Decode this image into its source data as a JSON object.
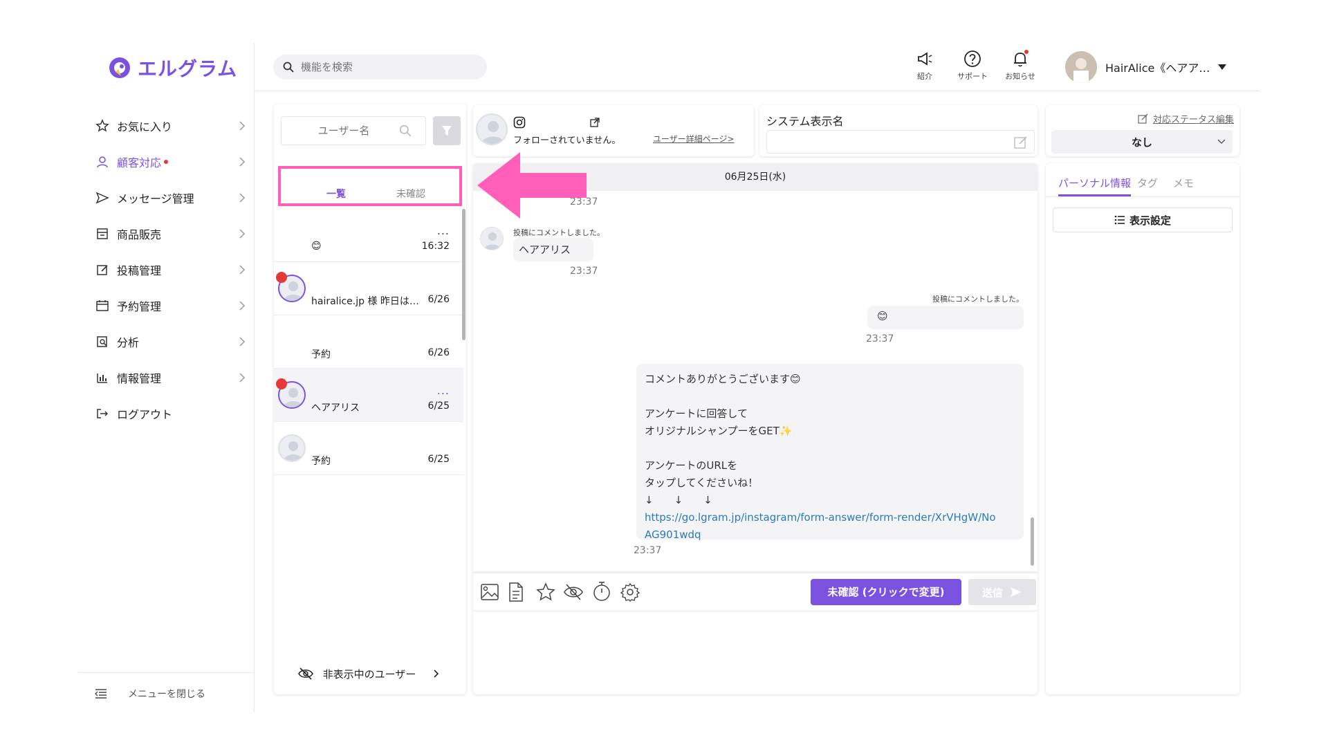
{
  "app": {
    "logo_text": "エルグラム"
  },
  "sidebar": {
    "items": [
      {
        "label": "お気に入り",
        "icon": "star-icon"
      },
      {
        "label": "顧客対応",
        "icon": "person-icon",
        "active": true,
        "badge": true
      },
      {
        "label": "メッセージ管理",
        "icon": "send-icon"
      },
      {
        "label": "商品販売",
        "icon": "shop-icon"
      },
      {
        "label": "投稿管理",
        "icon": "edit-icon"
      },
      {
        "label": "予約管理",
        "icon": "calendar-icon"
      },
      {
        "label": "分析",
        "icon": "analysis-icon"
      },
      {
        "label": "情報管理",
        "icon": "bar-chart-icon"
      },
      {
        "label": "ログアウト",
        "icon": "logout-icon"
      }
    ],
    "close_label": "メニューを閉じる"
  },
  "header": {
    "search_placeholder": "機能を検索",
    "buttons": [
      {
        "label": "紹介",
        "icon": "megaphone-icon"
      },
      {
        "label": "サポート",
        "icon": "help-icon"
      },
      {
        "label": "お知らせ",
        "icon": "bell-icon"
      }
    ],
    "user_name": "HairAlice《ヘアア…"
  },
  "user_list": {
    "search_placeholder": "ユーザー名",
    "tabs": [
      "一覧",
      "未確認"
    ],
    "rows": [
      {
        "name": "😊",
        "time": "16:32",
        "unread": false,
        "more": "..."
      },
      {
        "name": "hairalice.jp 様 昨日は…",
        "time": "6/26",
        "unread": true,
        "more": ""
      },
      {
        "name": "予約",
        "time": "6/26",
        "unread": false,
        "more": ""
      },
      {
        "name": "ヘアアリス",
        "time": "6/25",
        "unread": true,
        "more": "..."
      },
      {
        "name": "予約",
        "time": "6/25",
        "unread": false,
        "more": ""
      }
    ],
    "hidden_users_label": "非表示中のユーザー"
  },
  "chat_header": {
    "follow_status": "フォローされていません。",
    "user_detail_link": "ユーザー詳細ページ>"
  },
  "system_name": {
    "label": "システム表示名",
    "value": ""
  },
  "status": {
    "edit_label": "対応ステータス編集",
    "value": "なし"
  },
  "chat": {
    "date": "06月25日(水)",
    "messages": [
      {
        "side": "left",
        "time": "23:37"
      },
      {
        "side": "left",
        "caption": "投稿にコメントしました。",
        "text": "ヘアアリス",
        "time": "23:37"
      },
      {
        "side": "right",
        "caption": "投稿にコメントしました。",
        "text": "😊",
        "time": "23:37"
      },
      {
        "side": "right",
        "lines": [
          "コメントありがとうございます😊",
          "",
          "アンケートに回答して",
          "オリジナルシャンプーをGET✨",
          "",
          "アンケートのURLを",
          "タップしてくださいね！",
          "↓　　↓　　↓"
        ],
        "link": "https://go.lgram.jp/instagram/form-answer/form-render/XrVHgW/NoAG901wdq",
        "link_line1": "https://go.lgram.jp/instagram/form-answer/form-render/XrVHgW/No",
        "link_line2": "AG901wdq",
        "time": "23:37"
      }
    ],
    "unconfirmed_button": "未確認 (クリックで変更)",
    "send_button": "送信"
  },
  "info_panel": {
    "tabs": [
      "パーソナル情報",
      "タグ",
      "メモ"
    ],
    "display_settings": "表示設定"
  },
  "colors": {
    "accent": "#7b52e0",
    "highlight": "#ff5fb8",
    "link": "#2a7ab8",
    "unread": "#e53935"
  }
}
